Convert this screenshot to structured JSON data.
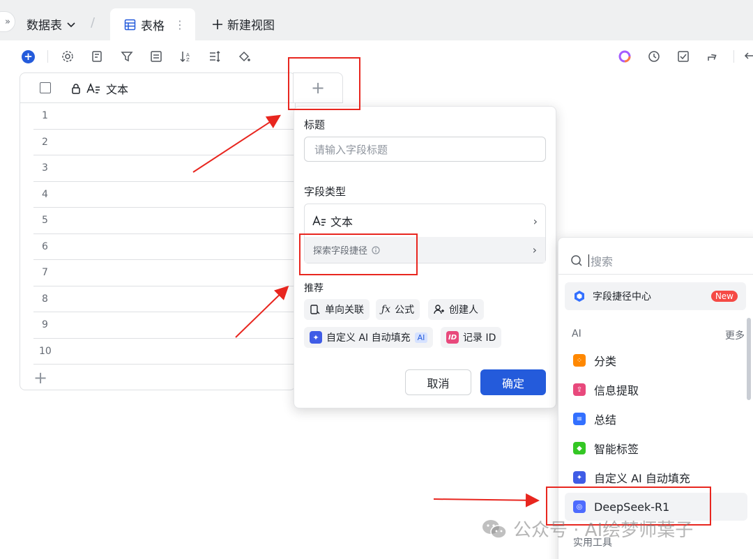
{
  "topbar": {
    "expand_glyph": "»",
    "db_label": "数据表",
    "active_tab": "表格",
    "new_view": "新建视图"
  },
  "grid": {
    "column_title": "文本",
    "rows": [
      "1",
      "2",
      "3",
      "4",
      "5",
      "6",
      "7",
      "8",
      "9",
      "10"
    ]
  },
  "field_panel": {
    "title_label": "标题",
    "title_placeholder": "请输入字段标题",
    "type_label": "字段类型",
    "type_value": "文本",
    "explore_label": "探索字段捷径",
    "recommend_label": "推荐",
    "chips": {
      "single_link": "单向关联",
      "formula": "公式",
      "creator": "创建人",
      "custom_ai": "自定义 AI 自动填充",
      "ai_badge": "AI",
      "record_id": "记录 ID",
      "id_badge": "ID"
    },
    "cancel": "取消",
    "confirm": "确定"
  },
  "shortcut_panel": {
    "search_placeholder": "搜索",
    "center_label": "字段捷径中心",
    "new_badge": "New",
    "section_ai": "AI",
    "more": "更多",
    "items": [
      "分类",
      "信息提取",
      "总结",
      "智能标签",
      "自定义 AI 自动填充",
      "DeepSeek-R1"
    ],
    "section_tools": "实用工具"
  },
  "watermark": "公众号 · AI绘梦师葉子",
  "colors": {
    "primary": "#245bdb",
    "highlight_red": "#e8261f",
    "orange": "#ff8800",
    "pink": "#e8497c",
    "blue": "#3370ff",
    "green": "#34c724",
    "indigo": "#3f5ce6"
  }
}
